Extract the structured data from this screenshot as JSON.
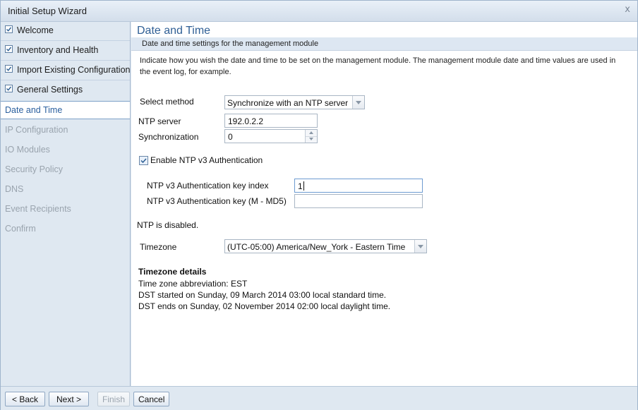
{
  "window": {
    "title": "Initial Setup Wizard",
    "close_glyph": "x"
  },
  "sidebar": {
    "items": [
      {
        "label": "Welcome",
        "state": "done"
      },
      {
        "label": "Inventory and Health",
        "state": "done"
      },
      {
        "label": "Import Existing Configuration",
        "state": "done"
      },
      {
        "label": "General Settings",
        "state": "done"
      },
      {
        "label": "Date and Time",
        "state": "active"
      },
      {
        "label": "IP Configuration",
        "state": "disabled"
      },
      {
        "label": "IO Modules",
        "state": "disabled"
      },
      {
        "label": "Security Policy",
        "state": "disabled"
      },
      {
        "label": "DNS",
        "state": "disabled"
      },
      {
        "label": "Event Recipients",
        "state": "disabled"
      },
      {
        "label": "Confirm",
        "state": "disabled"
      }
    ]
  },
  "main": {
    "title": "Date and Time",
    "subtitle": "Date and time settings for the management module",
    "description": "Indicate how you wish the date and time to be set on the management module. The management module date and time values are used in the event log, for example.",
    "select_method": {
      "label": "Select method",
      "value": "Synchronize with an NTP server"
    },
    "ntp_server": {
      "label": "NTP server",
      "value": "192.0.2.2"
    },
    "synchronization": {
      "label": "Synchronization",
      "value": "0"
    },
    "ntp_auth": {
      "label": "Enable NTP v3 Authentication",
      "checked": true
    },
    "key_index": {
      "label": "NTP v3 Authentication key index",
      "value": "1"
    },
    "key": {
      "label": "NTP v3 Authentication key (M - MD5)",
      "value": ""
    },
    "ntp_status": "NTP is disabled.",
    "timezone": {
      "label": "Timezone",
      "value": "(UTC-05:00) America/New_York - Eastern Time"
    },
    "timezone_details": {
      "heading": "Timezone details",
      "lines": [
        "Time zone abbreviation: EST",
        "DST started on Sunday, 09 March 2014 03:00 local standard time.",
        "DST ends on Sunday, 02 November 2014 02:00 local daylight time."
      ]
    }
  },
  "footer": {
    "back_label": "< Back",
    "next_label": "Next >",
    "finish_label": "Finish",
    "cancel_label": "Cancel"
  },
  "colors": {
    "accent": "#2f5f95",
    "sidebar_bg": "#dfe8f1",
    "disabled_text": "#9aa4ae"
  },
  "icons": {
    "checkmark": "check-icon",
    "dropdown": "chevron-down-icon",
    "close": "close-icon"
  }
}
